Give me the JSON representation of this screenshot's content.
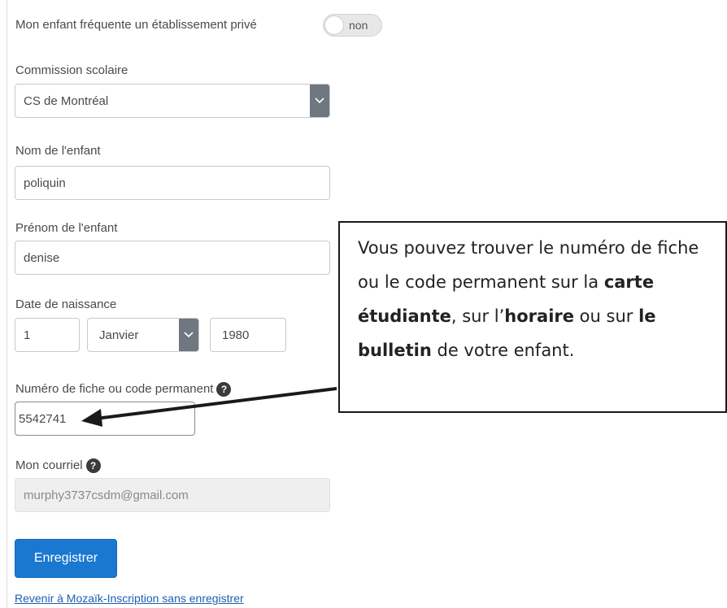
{
  "form": {
    "private_school_label": "Mon enfant fréquente un établissement privé",
    "private_school_toggle": "non",
    "school_board_label": "Commission scolaire",
    "school_board_value": "CS de Montréal",
    "child_lastname_label": "Nom de l'enfant",
    "child_lastname_value": "poliquin",
    "child_firstname_label": "Prénom de l'enfant",
    "child_firstname_value": "denise",
    "birthdate_label": "Date de naissance",
    "birth_day": "1",
    "birth_month": "Janvier",
    "birth_year": "1980",
    "file_number_label": "Numéro de fiche ou code permanent",
    "file_number_value": "5542741",
    "email_label": "Mon courriel",
    "email_value": "murphy3737csdm@gmail.com",
    "help_glyph": "?",
    "save_button": "Enregistrer",
    "back_link": "Revenir à Mozaïk-Inscription sans enregistrer"
  },
  "callout": {
    "part1": "Vous pouvez trouver le numéro de fiche ou le code permanent sur la ",
    "bold1": "carte étudiante",
    "part2": ", sur l’",
    "bold2": "horaire",
    "part3": " ou sur ",
    "bold3": "le bulletin",
    "part4": " de votre enfant."
  },
  "colors": {
    "primary_button": "#1b78d0",
    "link": "#1f5fb0",
    "select_arrow_bg": "#6f7780"
  }
}
